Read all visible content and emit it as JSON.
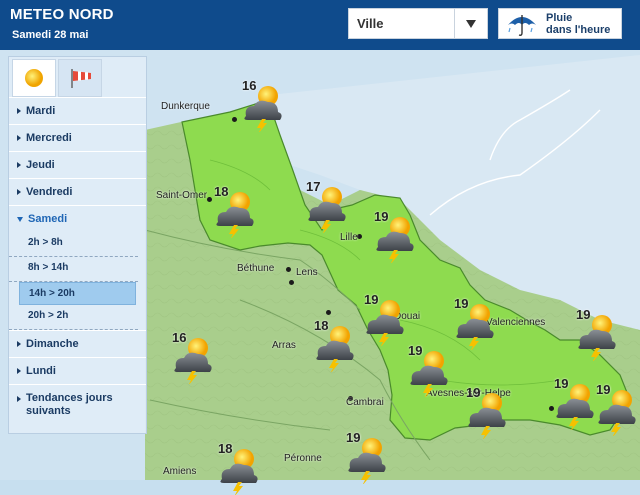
{
  "header": {
    "title": "METEO NORD",
    "date": "Samedi 28 mai",
    "ville_label": "Ville",
    "pluie_line1": "Pluie",
    "pluie_line2": "dans l'heure"
  },
  "sidebar": {
    "days": [
      {
        "label": "Mardi"
      },
      {
        "label": "Mercredi"
      },
      {
        "label": "Jeudi"
      },
      {
        "label": "Vendredi"
      },
      {
        "label": "Samedi",
        "active": true
      },
      {
        "label": "Dimanche"
      },
      {
        "label": "Lundi"
      },
      {
        "label": "Tendances jours suivants"
      }
    ],
    "slots": [
      "2h > 8h",
      "8h > 14h",
      "14h > 20h",
      "20h > 2h"
    ],
    "selected_slot": "14h > 20h"
  },
  "map": {
    "cities": [
      {
        "name": "Dunkerque"
      },
      {
        "name": "Saint-Omer"
      },
      {
        "name": "Lille"
      },
      {
        "name": "Béthune"
      },
      {
        "name": "Lens"
      },
      {
        "name": "Douai"
      },
      {
        "name": "Valenciennes"
      },
      {
        "name": "Arras"
      },
      {
        "name": "Cambrai"
      },
      {
        "name": "Avesnes-sur-Helpe"
      },
      {
        "name": "Amiens"
      },
      {
        "name": "Péronne"
      }
    ],
    "forecasts": [
      {
        "temp": "16",
        "icon": "storm-sun-icon"
      },
      {
        "temp": "18",
        "icon": "storm-sun-icon"
      },
      {
        "temp": "17",
        "icon": "storm-sun-icon"
      },
      {
        "temp": "19",
        "icon": "storm-sun-icon"
      },
      {
        "temp": "19",
        "icon": "storm-sun-icon"
      },
      {
        "temp": "19",
        "icon": "storm-sun-icon"
      },
      {
        "temp": "19",
        "icon": "storm-sun-icon"
      },
      {
        "temp": "18",
        "icon": "storm-sun-icon"
      },
      {
        "temp": "19",
        "icon": "storm-sun-icon"
      },
      {
        "temp": "16",
        "icon": "storm-sun-icon"
      },
      {
        "temp": "19",
        "icon": "storm-sun-icon"
      },
      {
        "temp": "19",
        "icon": "storm-sun-icon"
      },
      {
        "temp": "19",
        "icon": "storm-sun-icon"
      },
      {
        "temp": "18",
        "icon": "storm-sun-icon"
      },
      {
        "temp": "19",
        "icon": "storm-sun-icon"
      }
    ]
  },
  "colors": {
    "header_bg": "#0f4b8c",
    "region_green": "#8edb4f",
    "land_green": "#a9ce8c",
    "sea": "#cfe3f1"
  }
}
